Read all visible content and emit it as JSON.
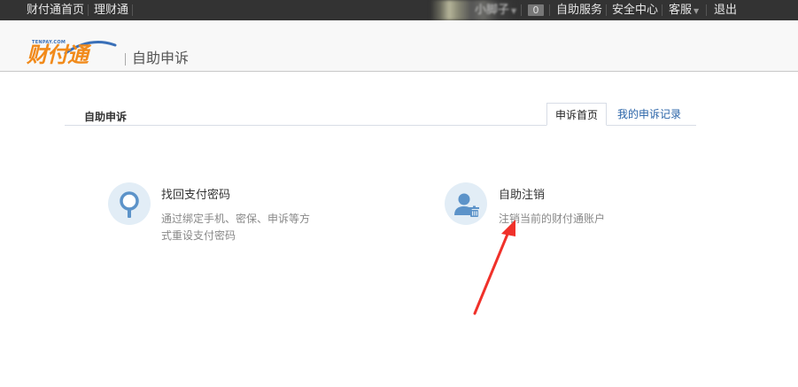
{
  "topbar": {
    "home": "财付通首页",
    "finance": "理财通",
    "user": "小脚子",
    "badge": "0",
    "self_service": "自助服务",
    "security": "安全中心",
    "service": "客服",
    "logout": "退出"
  },
  "header": {
    "logo_small": "TENPAY.COM",
    "logo_text": "财付通",
    "title": "自助申诉"
  },
  "tabs": {
    "section_title": "自助申诉",
    "home": "申诉首页",
    "records": "我的申诉记录"
  },
  "cards": [
    {
      "title": "找回支付密码",
      "desc": "通过绑定手机、密保、申诉等方式重设支付密码",
      "icon": "magnifier-icon"
    },
    {
      "title": "自助注销",
      "desc": "注销当前的财付通账户",
      "icon": "user-trash-icon"
    }
  ],
  "colors": {
    "topbar": "#333333",
    "logo": "#f18a1a",
    "link": "#2a64a8",
    "icon_bg": "#e2edf6",
    "icon_fg": "#5c93c9",
    "arrow": "#f0312a"
  }
}
